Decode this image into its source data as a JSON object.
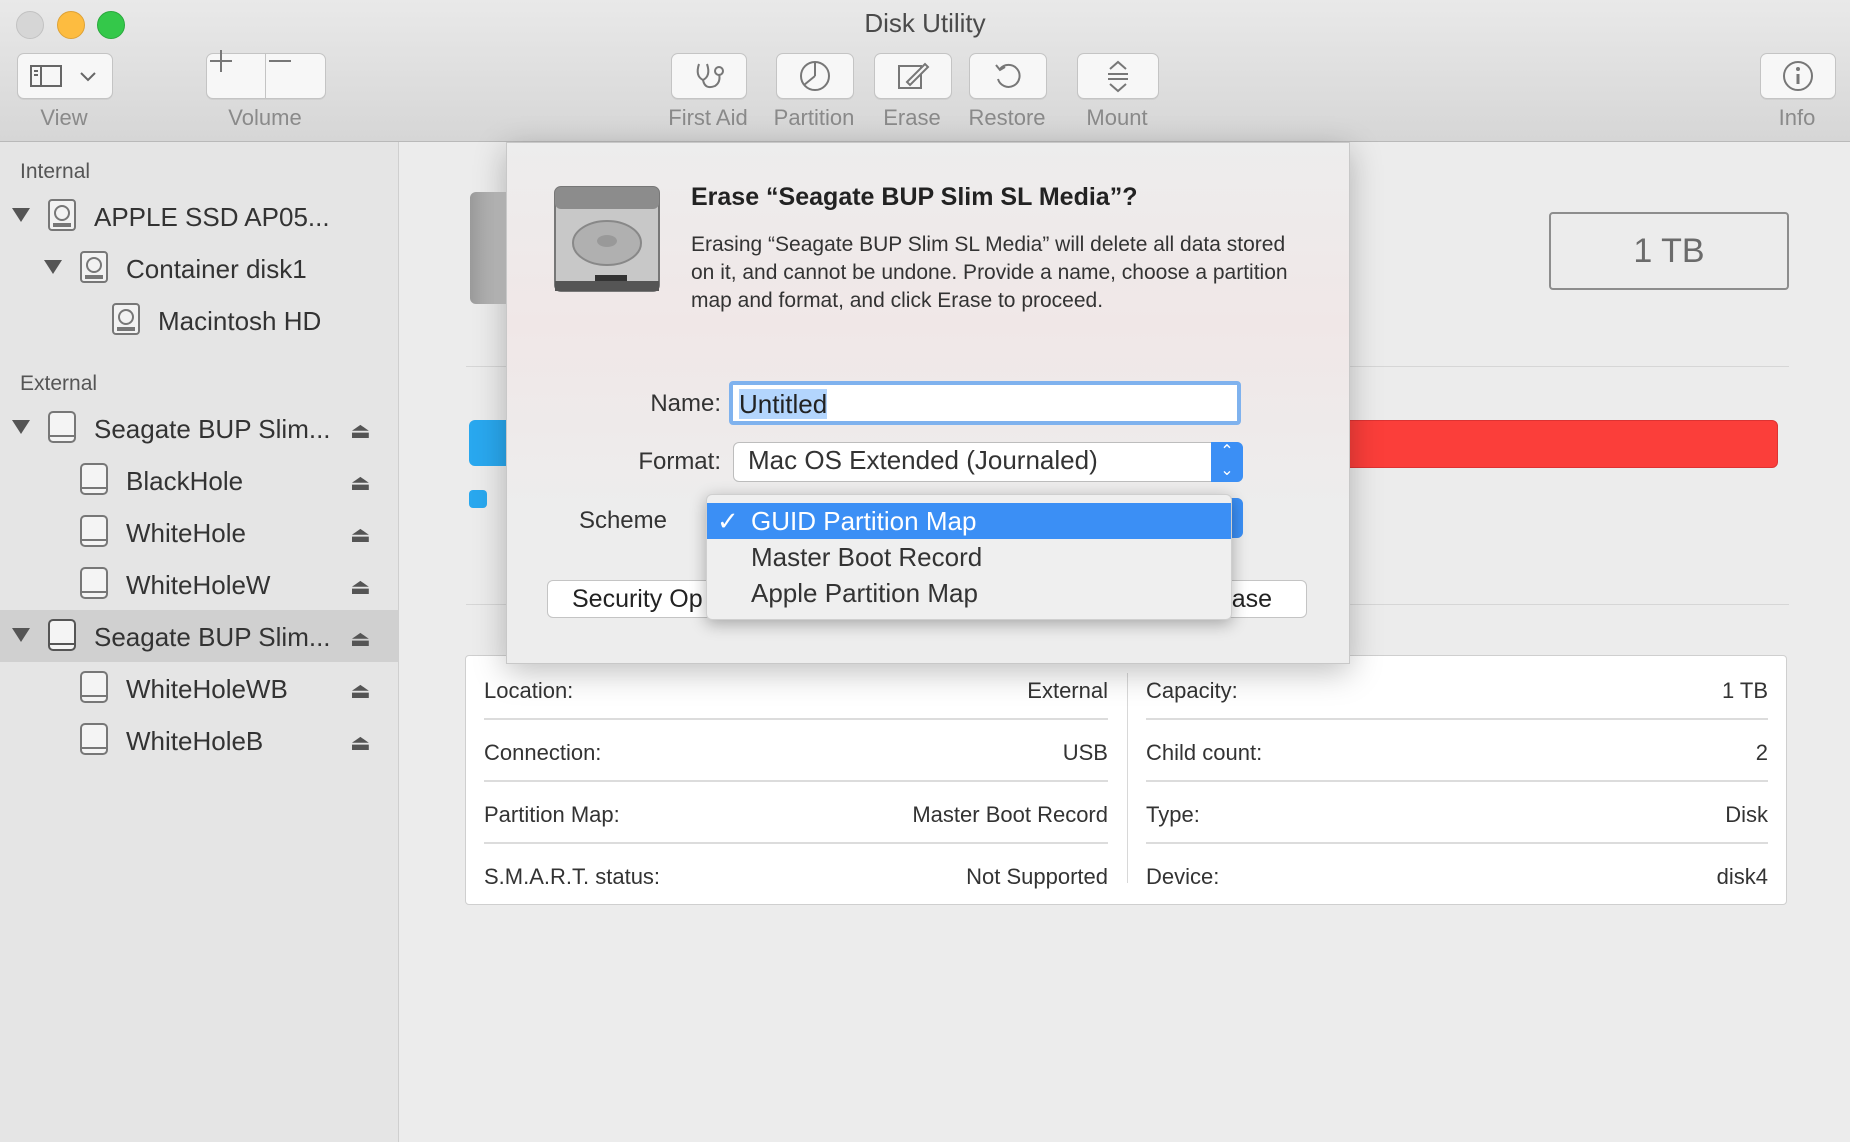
{
  "window": {
    "title": "Disk Utility"
  },
  "colors": {
    "close": "#fc605b",
    "minimize": "#fdbc40",
    "zoom": "#34c84a",
    "accent": "#3b8ff5",
    "used": "#29a8ef",
    "free": "#fb3e3a"
  },
  "toolbar": {
    "view": "View",
    "volume": "Volume",
    "first_aid": "First Aid",
    "partition": "Partition",
    "erase": "Erase",
    "restore": "Restore",
    "mount": "Mount",
    "info": "Info",
    "icons": [
      "sidebar-icon",
      "chevron-down-icon",
      "plus-icon",
      "minus-icon",
      "stethoscope-icon",
      "pie-chart-icon",
      "erase-pen-icon",
      "restore-arrow-icon",
      "mount-icon",
      "info-icon"
    ]
  },
  "sidebar": {
    "internal_label": "Internal",
    "external_label": "External",
    "internal": [
      {
        "label": "APPLE SSD AP05...",
        "level": 0
      },
      {
        "label": "Container disk1",
        "level": 1
      },
      {
        "label": "Macintosh HD",
        "level": 2
      }
    ],
    "external": [
      {
        "label": "Seagate BUP Slim...",
        "level": 0
      },
      {
        "label": "BlackHole",
        "level": 1
      },
      {
        "label": "WhiteHole",
        "level": 1
      },
      {
        "label": "WhiteHoleW",
        "level": 1
      },
      {
        "label": "Seagate BUP Slim...",
        "level": 0
      },
      {
        "label": "WhiteHoleWB",
        "level": 1
      },
      {
        "label": "WhiteHoleB",
        "level": 1
      }
    ]
  },
  "main": {
    "capacity_badge": "1 TB",
    "info": {
      "location_label": "Location:",
      "location": "External",
      "capacity_label": "Capacity:",
      "capacity": "1 TB",
      "connection_label": "Connection:",
      "connection": "USB",
      "child_count_label": "Child count:",
      "child_count": "2",
      "partition_map_label": "Partition Map:",
      "partition_map": "Master Boot Record",
      "type_label": "Type:",
      "type": "Disk",
      "smart_label": "S.M.A.R.T. status:",
      "smart": "Not Supported",
      "device_label": "Device:",
      "device": "disk4"
    }
  },
  "sheet": {
    "title": "Erase “Seagate BUP Slim SL Media”?",
    "description": "Erasing “Seagate BUP Slim SL Media” will delete all data stored on it, and cannot be undone. Provide a name, choose a partition map and format, and click Erase to proceed.",
    "name_label": "Name:",
    "name_value": "Untitled",
    "format_label": "Format:",
    "format_value": "Mac OS Extended (Journaled)",
    "scheme_label": "Scheme",
    "security_button": "Security Op",
    "erase_button": "ase",
    "scheme_options": [
      "GUID Partition Map",
      "Master Boot Record",
      "Apple Partition Map"
    ],
    "scheme_selected": "✓"
  }
}
